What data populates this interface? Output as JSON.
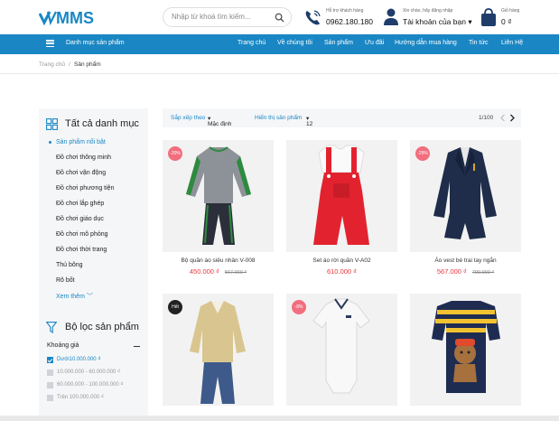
{
  "header": {
    "logo_text": "MMS",
    "search_placeholder": "Nhập từ khoá tìm kiếm...",
    "hotline_small": "Hỗ trợ khách hàng",
    "hotline_number": "0962.180.180",
    "account_small": "Xin chào, hãy đăng nhập",
    "account_label": "Tài khoản của bạn",
    "cart_small": "Giỏ hàng",
    "cart_total": "0 ₫"
  },
  "nav": {
    "categories_label": "Danh mục sản phẩm",
    "items": [
      "Trang chủ",
      "Về chúng tôi",
      "Sản phẩm",
      "Ưu đãi",
      "Hướng dẫn mua hàng",
      "Tin tức",
      "Liên Hệ"
    ]
  },
  "breadcrumb": [
    "Trang chủ",
    "/",
    "Sản phẩm"
  ],
  "sidebar": {
    "title": "Tất cả danh mục",
    "items": [
      "Sản phẩm nổi bật",
      "Đồ chơi thông minh",
      "Đồ chơi vận động",
      "Đồ chơi phương tiện",
      "Đồ chơi lắp ghép",
      "Đồ chơi giáo dục",
      "Đồ chơi mô phỏng",
      "Đồ chơi thời trang",
      "Thú bông",
      "Rô bốt"
    ],
    "more": "Xem thêm"
  },
  "filter": {
    "title": "Bộ lọc sản phẩm",
    "price_label": "Khoảng giá",
    "options": [
      "Dưới10.000.000 ₫",
      "10.000.000 - 60.000.000 ₫",
      "60.000.000 - 100.000.000 ₫",
      "Trên 100.000.000 ₫"
    ]
  },
  "sortbar": {
    "sort_label": "Sắp xếp theo",
    "sort_value": "Mặc định",
    "show_label": "Hiển thị sản phẩm",
    "show_value": "12",
    "page": "1/100"
  },
  "products": [
    {
      "name": "Bộ quần áo siêu nhân V-008",
      "price": "450.000 ₫",
      "old_price": "567.000 ₫",
      "badge": "-20%"
    },
    {
      "name": "Set áo rời quần V-A02",
      "price": "610.000 ₫",
      "old_price": "",
      "badge": ""
    },
    {
      "name": "Áo vest bé trai tay ngắn",
      "price": "567.000 ₫",
      "old_price": "790.000 ₫",
      "badge": "-29%"
    },
    {
      "name": "",
      "price": "",
      "old_price": "",
      "badge": "Hết"
    },
    {
      "name": "",
      "price": "",
      "old_price": "",
      "badge": "-8%"
    },
    {
      "name": "",
      "price": "",
      "old_price": "",
      "badge": ""
    }
  ],
  "colors": {
    "primary": "#1a87c4",
    "sale": "#e9353b",
    "badge": "#f26d7d"
  }
}
